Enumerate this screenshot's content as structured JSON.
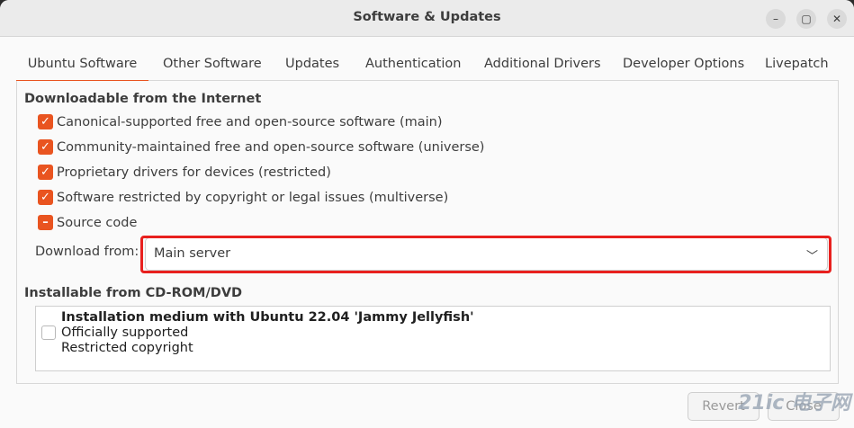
{
  "window": {
    "title": "Software & Updates",
    "controls": {
      "minimize": "–",
      "maximize": "▢",
      "close": "✕"
    }
  },
  "tabs": [
    {
      "label": "Ubuntu Software",
      "active": true
    },
    {
      "label": "Other Software",
      "active": false
    },
    {
      "label": "Updates",
      "active": false
    },
    {
      "label": "Authentication",
      "active": false
    },
    {
      "label": "Additional Drivers",
      "active": false
    },
    {
      "label": "Developer Options",
      "active": false
    },
    {
      "label": "Livepatch",
      "active": false
    }
  ],
  "downloadable": {
    "title": "Downloadable from the Internet",
    "options": [
      {
        "label": "Canonical-supported free and open-source software (main)",
        "state": "checked"
      },
      {
        "label": "Community-maintained free and open-source software (universe)",
        "state": "checked"
      },
      {
        "label": "Proprietary drivers for devices (restricted)",
        "state": "checked"
      },
      {
        "label": "Software restricted by copyright or legal issues (multiverse)",
        "state": "checked"
      },
      {
        "label": "Source code",
        "state": "mixed"
      }
    ],
    "download_from_label": "Download from:",
    "download_from_value": "Main server"
  },
  "cdrom": {
    "title": "Installable from CD-ROM/DVD",
    "entry": {
      "name": "Installation medium with Ubuntu 22.04 'Jammy Jellyfish'",
      "line2": "Officially supported",
      "line3": "Restricted copyright",
      "checked": false
    }
  },
  "buttons": {
    "revert": "Revert",
    "close": "Close"
  },
  "watermark": "21ic 电子网",
  "colors": {
    "accent": "#e95420",
    "highlight": "#e8201e"
  }
}
